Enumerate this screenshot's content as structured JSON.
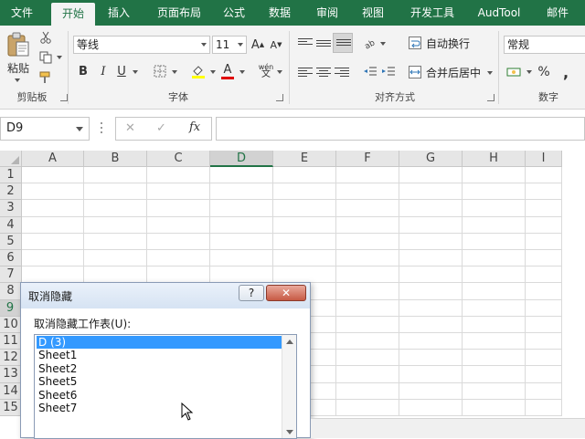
{
  "menu_tabs": [
    "文件",
    "开始",
    "插入",
    "页面布局",
    "公式",
    "数据",
    "审阅",
    "视图",
    "开发工具",
    "AudTool",
    "邮件"
  ],
  "active_tab": "开始",
  "ribbon": {
    "clipboard": {
      "paste_label": "粘贴",
      "group_label": "剪贴板"
    },
    "font": {
      "font_name": "等线",
      "font_size": "11",
      "grow_label": "A",
      "shrink_label": "A",
      "bold": "B",
      "italic": "I",
      "underline": "U",
      "font_color_label": "A",
      "phonetic_label": "wén",
      "group_label": "字体"
    },
    "alignment": {
      "wrap_text": "自动换行",
      "merge_center": "合并后居中",
      "group_label": "对齐方式"
    },
    "number": {
      "format": "常规",
      "percent": "%",
      "comma": ",",
      "group_label": "数字"
    }
  },
  "formula_bar": {
    "name_box": "D9",
    "cancel": "✕",
    "enter": "✓",
    "fx": "fx",
    "content": ""
  },
  "grid": {
    "columns": [
      "A",
      "B",
      "C",
      "D",
      "E",
      "F",
      "G",
      "H",
      "I"
    ],
    "rows": [
      "1",
      "2",
      "3",
      "4",
      "5",
      "6",
      "7",
      "8",
      "9",
      "10",
      "11",
      "12",
      "13",
      "14",
      "15"
    ],
    "selected_cell": "D9"
  },
  "dialog": {
    "title": "取消隐藏",
    "help": "?",
    "close": "✕",
    "prompt": "取消隐藏工作表(U):",
    "sheets": [
      "D (3)",
      "Sheet1",
      "Sheet2",
      "Sheet5",
      "Sheet6",
      "Sheet7"
    ],
    "selected_sheet": "D (3)"
  },
  "colors": {
    "accent": "#217346",
    "selection": "#3399ff"
  }
}
